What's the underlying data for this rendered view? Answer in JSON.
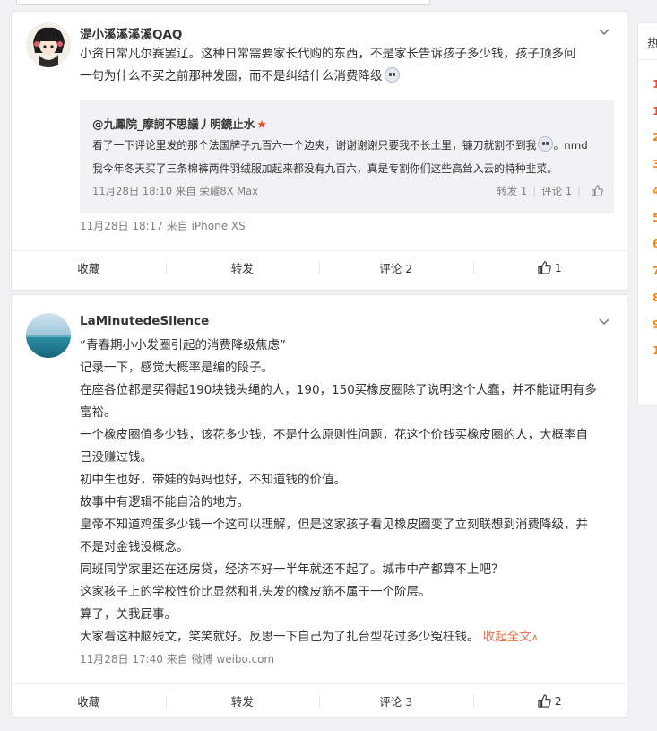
{
  "feed": {
    "comments": [
      {
        "username": "湜小溪溪溪溪QAQ",
        "text_line1": "小资日常凡尔赛罢辽。这种日常需要家长代购的东西，不是家长告诉孩子多少钱，孩子顶多问",
        "text_line2": "一句为什么不买之前那种发圈，而不是纠结什么消费降级",
        "quote": {
          "author": "@九鳳院_摩訶不思議丿明鏡止水",
          "line1": "看了一下评论里发的那个法国牌子九百六一个边夹，谢谢谢谢只要我不长土里，镰刀就割不到我",
          "line1_suffix": "。nmd",
          "line2": "我今年冬天买了三条棉裤两件羽绒服加起来都没有九百六，真是专割你们这些高耸入云的特种韭菜。",
          "meta": "11月28日 18:10 来自 荣耀8X Max",
          "repost": "转发 1",
          "comment": "评论 1"
        },
        "meta": "11月28日 18:17  来自 iPhone XS",
        "actions": {
          "fav": "收藏",
          "repost": "转发",
          "comment": "评论 2",
          "like": "1"
        }
      },
      {
        "username": "LaMinutedeSilence",
        "quote_title": "“青春期小小发圈引起的消费降级焦虑”",
        "lines": [
          "记录一下，感觉大概率是编的段子。",
          "在座各位都是买得起190块钱头绳的人，190，150买橡皮圈除了说明这个人蠢，并不能证明有多",
          "富裕。",
          "一个橡皮圈值多少钱，该花多少钱，不是什么原则性问题，花这个价钱买橡皮圈的人，大概率自",
          "己没赚过钱。",
          "初中生也好，带娃的妈妈也好，不知道钱的价值。",
          "故事中有逻辑不能自洽的地方。",
          "皇帝不知道鸡蛋多少钱一个这可以理解，但是这家孩子看见橡皮圈变了立刻联想到消费降级，并",
          "不是对金钱没概念。",
          "同班同学家里还在还房贷，经济不好一半年就还不起了。城市中产都算不上吧？",
          "这家孩子上的学校性价比显然和扎头发的橡皮筋不属于一个阶层。",
          "算了，关我屁事。"
        ],
        "last_line": "大家看这种脑残文，笑笑就好。反思一下自己为了扎台型花过多少冤枉钱。",
        "collapse": "收起全文",
        "meta": "11月28日 17:40  来自 微博 weibo.com",
        "actions": {
          "fav": "收藏",
          "repost": "转发",
          "comment": "评论 3",
          "like": "2"
        }
      }
    ]
  },
  "sidebar": {
    "heading": "热",
    "numbers": [
      "1",
      "1",
      "2",
      "3",
      "4",
      "5",
      "6",
      "7",
      "8",
      "9",
      "1"
    ]
  },
  "colors": {
    "accent": "#eb7350",
    "rank_hot": "#f24b24",
    "rank_warm": "#ff8200",
    "meta_gray": "#808080"
  }
}
